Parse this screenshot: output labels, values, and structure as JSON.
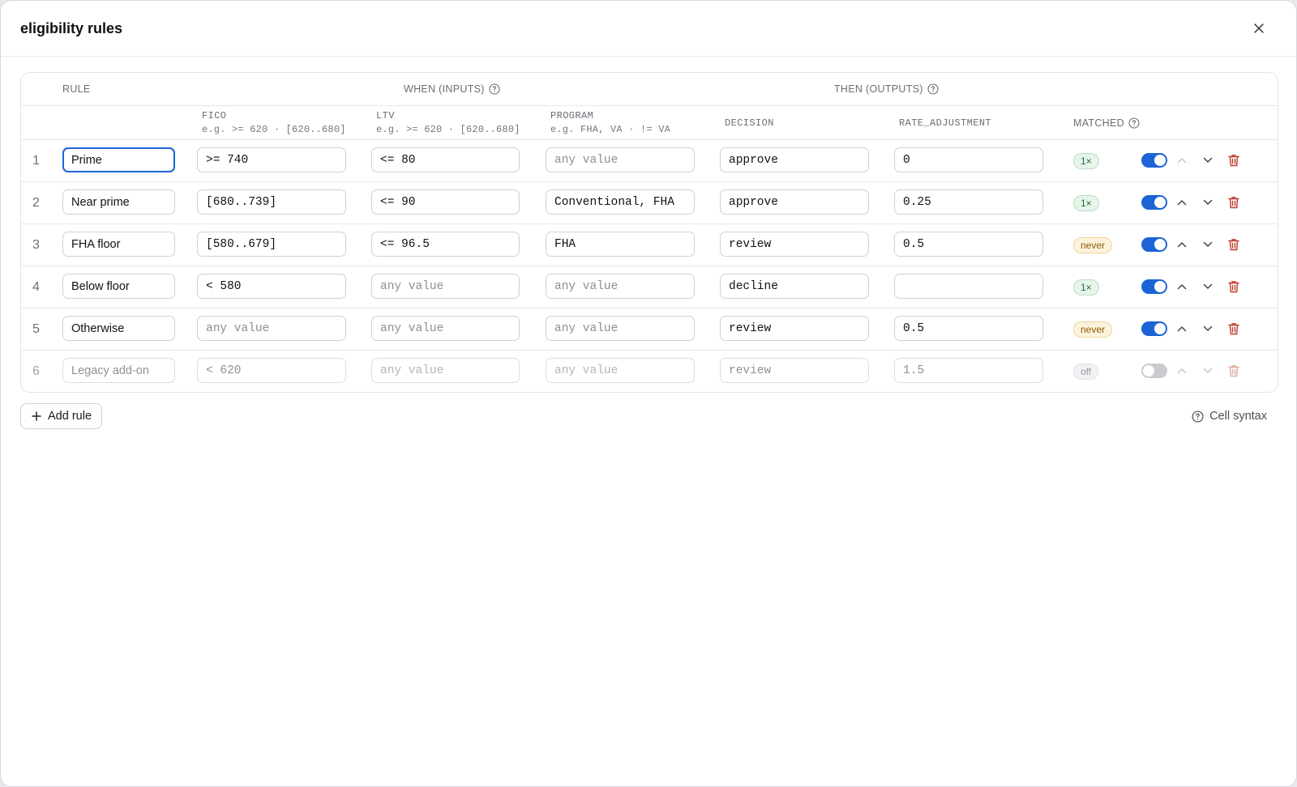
{
  "modal": {
    "title": "eligibility rules"
  },
  "groups": {
    "rule": "RULE",
    "when": "WHEN (INPUTS)",
    "then": "THEN (OUTPUTS)"
  },
  "columns": {
    "fico": {
      "name": "FICO",
      "hint": "e.g. >= 620 · [620..680]"
    },
    "ltv": {
      "name": "LTV",
      "hint": "e.g. >= 620 · [620..680]"
    },
    "program": {
      "name": "PROGRAM",
      "hint": "e.g. FHA, VA · != VA"
    },
    "decision": {
      "name": "DECISION"
    },
    "rate_adjustment": {
      "name": "RATE_ADJUSTMENT"
    },
    "matched": {
      "name": "MATCHED"
    }
  },
  "rules": [
    {
      "num": "1",
      "name": "Prime",
      "fico": ">= 740",
      "ltv": "<= 80",
      "program": "any value",
      "decision": "approve",
      "rate": "0",
      "matched": "1×",
      "matched_kind": "hit",
      "enabled": true
    },
    {
      "num": "2",
      "name": "Near prime",
      "fico": "[680..739]",
      "ltv": "<= 90",
      "program": "Conventional, FHA",
      "decision": "approve",
      "rate": "0.25",
      "matched": "1×",
      "matched_kind": "hit",
      "enabled": true
    },
    {
      "num": "3",
      "name": "FHA floor",
      "fico": "[580..679]",
      "ltv": "<= 96.5",
      "program": "FHA",
      "decision": "review",
      "rate": "0.5",
      "matched": "never",
      "matched_kind": "never",
      "enabled": true
    },
    {
      "num": "4",
      "name": "Below floor",
      "fico": "< 580",
      "ltv": "any value",
      "program": "any value",
      "decision": "decline",
      "rate": "",
      "matched": "1×",
      "matched_kind": "hit",
      "enabled": true
    },
    {
      "num": "5",
      "name": "Otherwise",
      "fico": "any value",
      "ltv": "any value",
      "program": "any value",
      "decision": "review",
      "rate": "0.5",
      "matched": "never",
      "matched_kind": "never",
      "enabled": true
    },
    {
      "num": "6",
      "name": "Legacy add-on",
      "fico": "< 620",
      "ltv": "any value",
      "program": "any value",
      "decision": "review",
      "rate": "1.5",
      "matched": "off",
      "matched_kind": "off",
      "enabled": false
    }
  ],
  "placeholder": "any value",
  "footer": {
    "add_rule": "Add rule",
    "cell_syntax": "Cell syntax"
  },
  "colors": {
    "accent": "#1c64d6",
    "delete": "#c0392b",
    "hit_bg": "#e6f4ea",
    "never_bg": "#fdf3dc"
  },
  "icons": {
    "close": "close-icon",
    "help": "help-circle-icon",
    "up": "chevron-up-icon",
    "down": "chevron-down-icon",
    "delete": "trash-icon",
    "add": "plus-icon"
  }
}
